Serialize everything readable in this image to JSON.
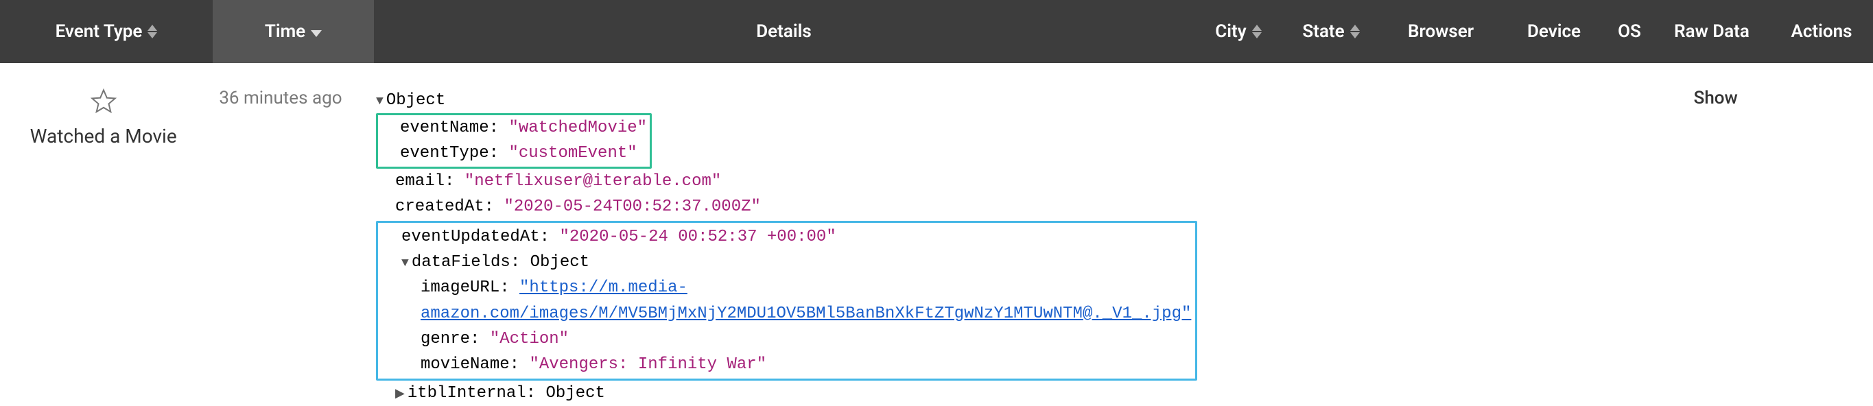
{
  "header": {
    "event_type": "Event Type",
    "time": "Time",
    "details": "Details",
    "city": "City",
    "state": "State",
    "browser": "Browser",
    "device": "Device",
    "os": "OS",
    "raw_data": "Raw Data",
    "actions": "Actions"
  },
  "row": {
    "event_type_label": "Watched a Movie",
    "time_label": "36 minutes ago",
    "raw_data_action": "Show",
    "details": {
      "root_label": "Object",
      "eventName_key": "eventName:",
      "eventName_val": "\"watchedMovie\"",
      "eventType_key": "eventType:",
      "eventType_val": "\"customEvent\"",
      "email_key": "email:",
      "email_val": "\"netflixuser@iterable.com\"",
      "createdAt_key": "createdAt:",
      "createdAt_val": "\"2020-05-24T00:52:37.000Z\"",
      "eventUpdatedAt_key": "eventUpdatedAt:",
      "eventUpdatedAt_val": "\"2020-05-24 00:52:37 +00:00\"",
      "dataFields_key": "dataFields:",
      "dataFields_type": "Object",
      "imageURL_key": "imageURL:",
      "imageURL_val": "\"https://m.media-amazon.com/images/M/MV5BMjMxNjY2MDU1OV5BMl5BanBnXkFtZTgwNzY1MTUwNTM@._V1_.jpg\"",
      "genre_key": "genre:",
      "genre_val": "\"Action\"",
      "movieName_key": "movieName:",
      "movieName_val": "\"Avengers: Infinity War\"",
      "itblInternal_key": "itblInternal:",
      "itblInternal_type": "Object"
    }
  }
}
